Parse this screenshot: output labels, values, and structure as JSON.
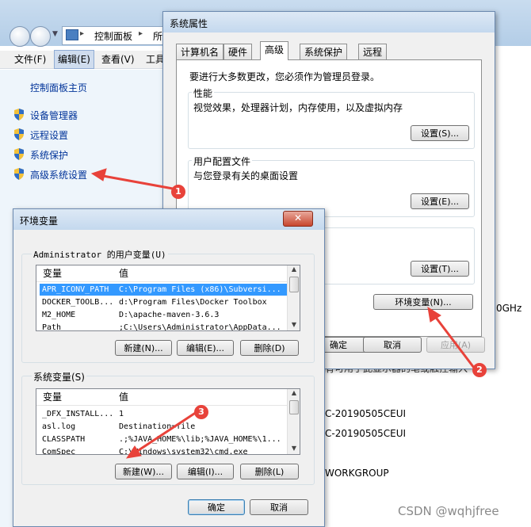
{
  "explorer": {
    "breadcrumb_root": "控制面板",
    "breadcrumb_next": "所",
    "menu": [
      "文件(F)",
      "编辑(E)",
      "查看(V)",
      "工具"
    ],
    "sidebar_home": "控制面板主页",
    "sidebar_links": [
      "设备管理器",
      "远程设置",
      "系统保护",
      "高级系统设置"
    ],
    "right_texts": [
      "0GHz",
      "有可用于此显示器的笔或触控输入",
      "C-20190505CEUI",
      "C-20190505CEUI",
      "WORKGROUP"
    ]
  },
  "sysprops": {
    "title": "系统属性",
    "tabs": [
      "计算机名",
      "硬件",
      "高级",
      "系统保护",
      "远程"
    ],
    "admin_note": "要进行大多数更改，您必须作为管理员登录。",
    "performance": {
      "title": "性能",
      "desc": "视觉效果，处理器计划，内存使用，以及虚拟内存",
      "button": "设置(S)..."
    },
    "profile": {
      "title": "用户配置文件",
      "desc": "与您登录有关的桌面设置",
      "button": "设置(E)..."
    },
    "startup": {
      "button": "设置(T)..."
    },
    "env_button": "环境变量(N)...",
    "ok": "确定",
    "cancel": "取消",
    "apply": "应用(A)"
  },
  "envvars": {
    "title": "环境变量",
    "close": "✕",
    "user_group": "Administrator 的用户变量(U)",
    "col_var": "变量",
    "col_val": "值",
    "user_rows": [
      {
        "name": "APR_ICONV_PATH",
        "value": "C:\\Program Files (x86)\\Subversi..."
      },
      {
        "name": "DOCKER_TOOLB...",
        "value": "d:\\Program Files\\Docker Toolbox"
      },
      {
        "name": "M2_HOME",
        "value": "D:\\apache-maven-3.6.3"
      },
      {
        "name": "Path",
        "value": ";C:\\Users\\Administrator\\AppData..."
      }
    ],
    "user_new": "新建(N)...",
    "user_edit": "编辑(E)...",
    "user_delete": "删除(D)",
    "sys_group": "系统变量(S)",
    "sys_rows": [
      {
        "name": "_DFX_INSTALL...",
        "value": "1"
      },
      {
        "name": "asl.log",
        "value": "Destination=file"
      },
      {
        "name": "CLASSPATH",
        "value": ".;%JAVA_HOME%\\lib;%JAVA_HOME%\\1..."
      },
      {
        "name": "ComSpec",
        "value": "C:\\Windows\\system32\\cmd.exe"
      }
    ],
    "sys_new": "新建(W)...",
    "sys_edit": "编辑(I)...",
    "sys_delete": "删除(L)",
    "ok": "确定",
    "cancel": "取消"
  },
  "annotations": {
    "badges": [
      "1",
      "2",
      "3"
    ],
    "arrow_color": "#e8423a"
  },
  "watermark": "CSDN @wqhjfree"
}
